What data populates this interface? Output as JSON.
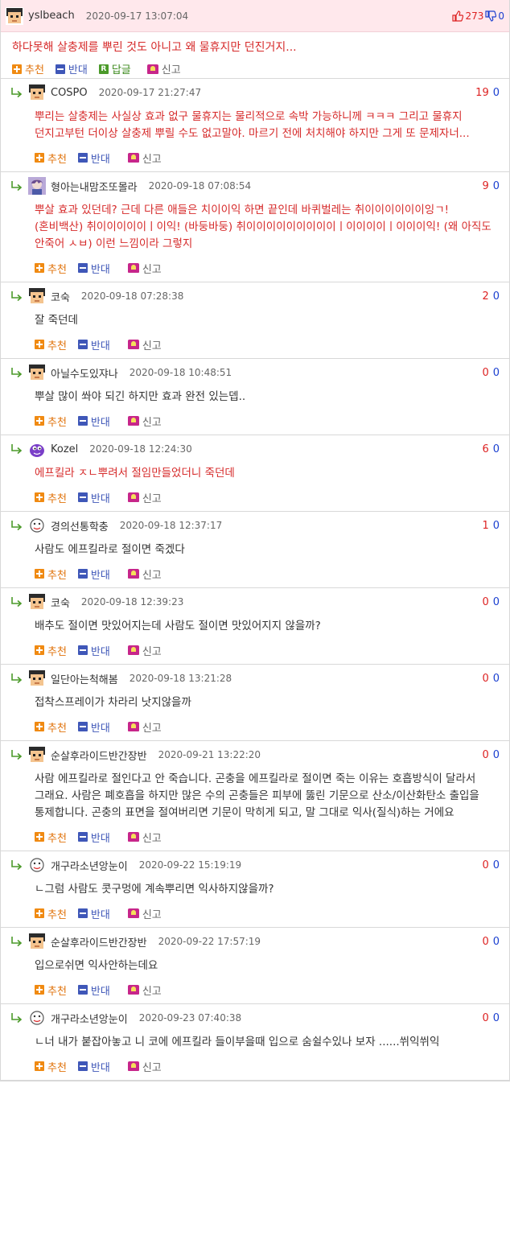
{
  "post": {
    "nickname": "yslbeach",
    "date": "2020-09-17 13:07:04",
    "up_count": "273",
    "down_count": "0",
    "title": "하다못해 살충제를 뿌린 것도 아니고 왜 물휴지만 던진거지...",
    "actions": {
      "recommend": "추천",
      "oppose": "반대",
      "reply_icon": "R",
      "reply": "답글",
      "report": "신고"
    }
  },
  "colors": {
    "header_bg": "#ffe8ec",
    "highlight_text": "#d62a2a",
    "up": "#dd2222",
    "down": "#1a3fd0",
    "recommend": "#f08a12",
    "oppose": "#3f57b8"
  },
  "comment_actions": {
    "recommend": "추천",
    "oppose": "반대",
    "report": "신고"
  },
  "comments": [
    {
      "nickname": "COSPO",
      "date": "2020-09-17 21:27:47",
      "up": "19",
      "down": "0",
      "avatar": "pixel-face-icon",
      "highlight": true,
      "text": "뿌리는 살충제는 사실상 효과 없구 물휴지는 물리적으로 속박 가능하니께 ㅋㅋㅋ 그리고 물휴지 던지고부턴 더이상 살충제 뿌릴 수도 없고말야. 마르기 전에 처치해야 하지만 그게 또 문제자너..."
    },
    {
      "nickname": "형아는내맘조또몰라",
      "date": "2020-09-18 07:08:54",
      "up": "9",
      "down": "0",
      "avatar": "anime-avatar-icon",
      "highlight": true,
      "text": "뿌살 효과 있던데? 근데 다른 애들은 치이이익 하면 끝인데 바퀴벌레는 취이이이이이이잉ㄱ! (혼비백산) 취이이이이이ㅣ이익! (바둥바둥) 취이이이이이이이이이ㅣ이이이이ㅣ이이이익! (왜 아직도 안죽어 ㅅㅂ) 이런 느낌이라 그렇지"
    },
    {
      "nickname": "코숙",
      "date": "2020-09-18 07:28:38",
      "up": "2",
      "down": "0",
      "avatar": "pixel-face-icon",
      "highlight": false,
      "text": "잘 죽던데"
    },
    {
      "nickname": "아닐수도있쟈나",
      "date": "2020-09-18 10:48:51",
      "up": "0",
      "down": "0",
      "avatar": "pixel-face-icon",
      "highlight": false,
      "text": "뿌살 많이 쏴야 되긴 하지만 효과 완전 있는뎁.."
    },
    {
      "nickname": "Kozel",
      "date": "2020-09-18 12:24:30",
      "up": "6",
      "down": "0",
      "avatar": "purple-creature-icon",
      "highlight": true,
      "text": "에프킬라 ㅈㄴ뿌려서 절임만들었더니 죽던데"
    },
    {
      "nickname": "경의선통학충",
      "date": "2020-09-18 12:37:17",
      "up": "1",
      "down": "0",
      "avatar": "sketch-avatar-icon",
      "highlight": false,
      "text": "사람도 에프킬라로 절이면 죽겠다"
    },
    {
      "nickname": "코숙",
      "date": "2020-09-18 12:39:23",
      "up": "0",
      "down": "0",
      "avatar": "pixel-face-icon",
      "highlight": false,
      "text": "배추도 절이면 맛있어지는데 사람도 절이면 맛있어지지 않을까?"
    },
    {
      "nickname": "일단아는척해봄",
      "date": "2020-09-18 13:21:28",
      "up": "0",
      "down": "0",
      "avatar": "pixel-face-icon",
      "highlight": false,
      "text": "접착스프레이가 차라리 낫지않을까"
    },
    {
      "nickname": "순살후라이드반간장반",
      "date": "2020-09-21 13:22:20",
      "up": "0",
      "down": "0",
      "avatar": "pixel-face-icon",
      "highlight": false,
      "text": "사람 에프킬라로 절인다고 안 죽습니다. 곤충을 에프킬라로 절이면 죽는 이유는 호흡방식이 달라서 그래요. 사람은 폐호흡을 하지만 많은 수의 곤충들은 피부에 뚫린 기문으로 산소/이산화탄소 출입을 통제합니다. 곤충의 표면을 절여버리면 기문이 막히게 되고, 말 그대로 익사(질식)하는 거에요"
    },
    {
      "nickname": "개구라소년앙눈이",
      "date": "2020-09-22 15:19:19",
      "up": "0",
      "down": "0",
      "avatar": "sketch-avatar-icon",
      "highlight": false,
      "text": "ㄴ그럼 사람도 콧구멍에 계속뿌리면 익사하지않을까?"
    },
    {
      "nickname": "순살후라이드반간장반",
      "date": "2020-09-22 17:57:19",
      "up": "0",
      "down": "0",
      "avatar": "pixel-face-icon",
      "highlight": false,
      "text": "입으로쉬면 익사안하는데요"
    },
    {
      "nickname": "개구라소년앙눈이",
      "date": "2020-09-23 07:40:38",
      "up": "0",
      "down": "0",
      "avatar": "sketch-avatar-icon",
      "highlight": false,
      "text": "ㄴ너 내가 붙잡아놓고 니 코에 에프킬라 들이부을때 입으로 숨쉴수있나 보자 ......쒸익쒸익"
    }
  ]
}
